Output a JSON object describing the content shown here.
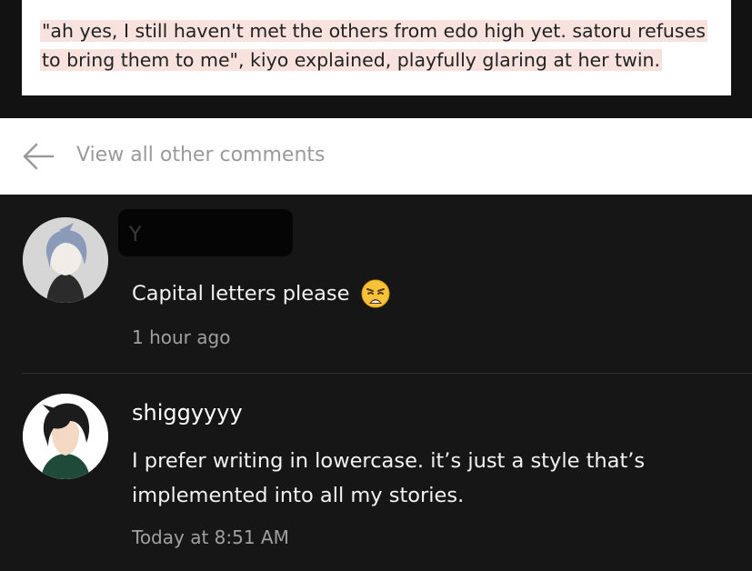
{
  "story_excerpt": {
    "text": "\"ah yes, I still haven't met the others from edo high yet. satoru refuses to bring them to me\", kiyo explained, playfully glaring at her twin."
  },
  "view_all": {
    "label": "View all other comments",
    "icon": "back-arrow-icon"
  },
  "comments": [
    {
      "author": "Y... (redacted)",
      "text": "Capital letters please",
      "emoji": "weary-face-emoji",
      "time": "1 hour ago"
    },
    {
      "author": "shiggyyyy",
      "text_line1": "I prefer writing in lowercase. it’s just a style that’s",
      "text_line2": "implemented into all my stories.",
      "time": "Today at 8:51 AM"
    }
  ],
  "colors": {
    "background": "#161616",
    "highlight": "#f8e2dd",
    "muted_text": "#a0a0a0"
  }
}
